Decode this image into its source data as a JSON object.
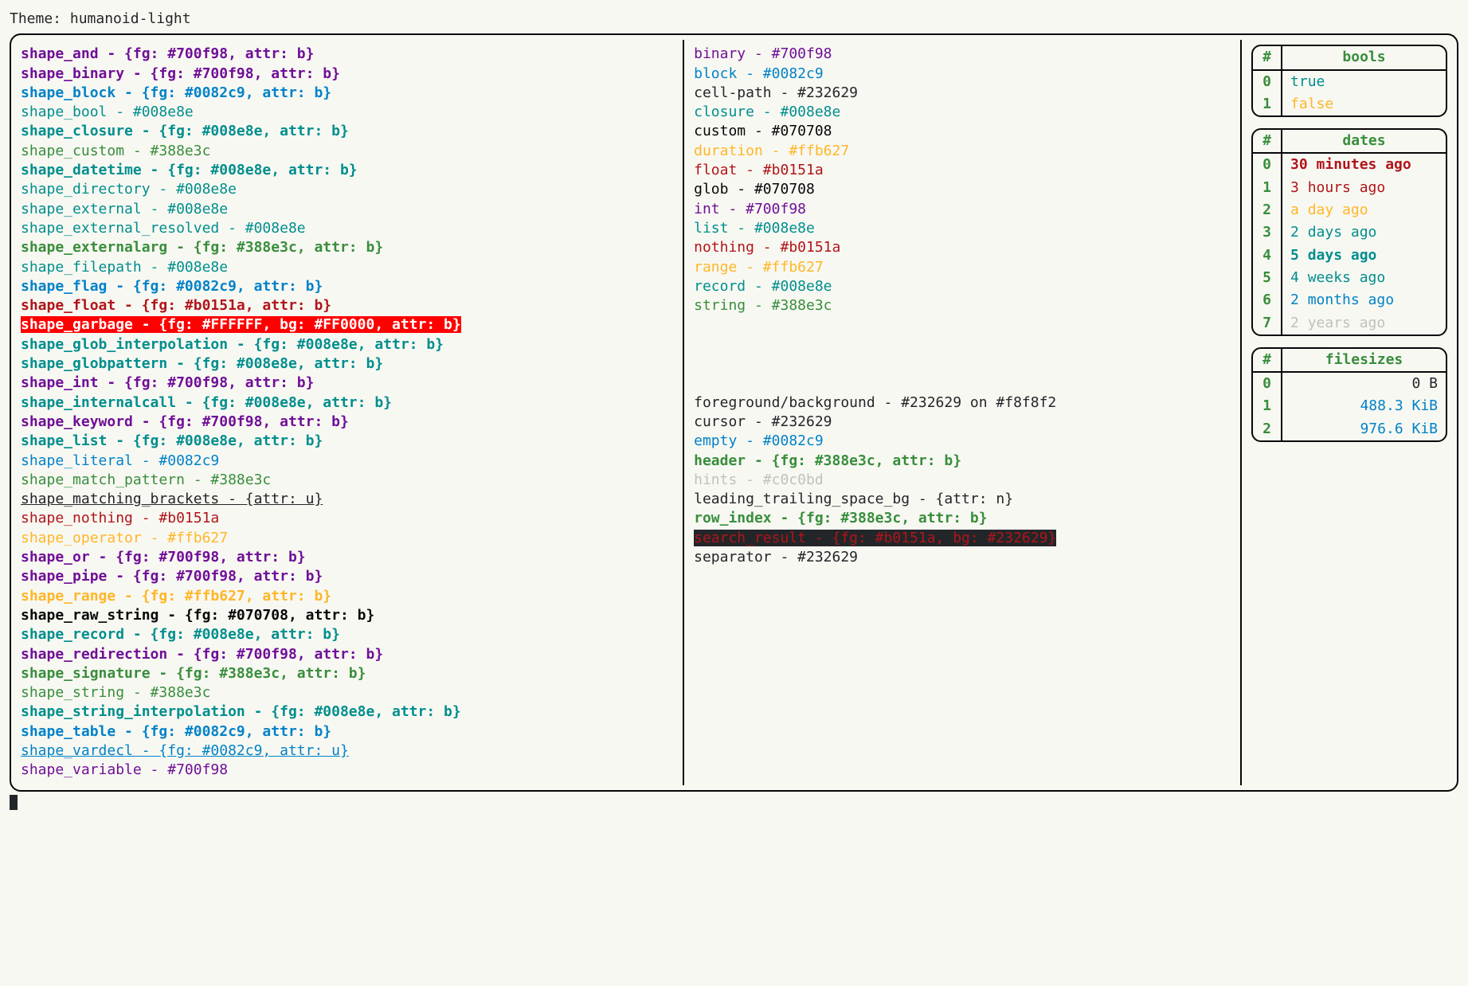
{
  "header": {
    "label": "Theme:",
    "name": "humanoid-light"
  },
  "palette": {
    "purple": "#700f98",
    "blue": "#0082c9",
    "teal": "#008e8e",
    "green": "#388e3c",
    "red": "#b0151a",
    "orange": "#ffb627",
    "black": "#070708",
    "fg": "#232629",
    "bg": "#f8f8f2",
    "hint": "#c0c0bd",
    "white": "#FFFFFF",
    "brightred": "#FF0000"
  },
  "shapes": [
    {
      "name": "shape_and",
      "val": "{fg: #700f98, attr: b}",
      "color": "purple",
      "bold": true
    },
    {
      "name": "shape_binary",
      "val": "{fg: #700f98, attr: b}",
      "color": "purple",
      "bold": true
    },
    {
      "name": "shape_block",
      "val": "{fg: #0082c9, attr: b}",
      "color": "blue",
      "bold": true
    },
    {
      "name": "shape_bool",
      "val": "#008e8e",
      "color": "teal",
      "bold": false
    },
    {
      "name": "shape_closure",
      "val": "{fg: #008e8e, attr: b}",
      "color": "teal",
      "bold": true
    },
    {
      "name": "shape_custom",
      "val": "#388e3c",
      "color": "green",
      "bold": false
    },
    {
      "name": "shape_datetime",
      "val": "{fg: #008e8e, attr: b}",
      "color": "teal",
      "bold": true
    },
    {
      "name": "shape_directory",
      "val": "#008e8e",
      "color": "teal",
      "bold": false
    },
    {
      "name": "shape_external",
      "val": "#008e8e",
      "color": "teal",
      "bold": false
    },
    {
      "name": "shape_external_resolved",
      "val": "#008e8e",
      "color": "teal",
      "bold": false
    },
    {
      "name": "shape_externalarg",
      "val": "{fg: #388e3c, attr: b}",
      "color": "green",
      "bold": true
    },
    {
      "name": "shape_filepath",
      "val": "#008e8e",
      "color": "teal",
      "bold": false
    },
    {
      "name": "shape_flag",
      "val": "{fg: #0082c9, attr: b}",
      "color": "blue",
      "bold": true
    },
    {
      "name": "shape_float",
      "val": "{fg: #b0151a, attr: b}",
      "color": "red",
      "bold": true
    },
    {
      "name": "shape_garbage",
      "val": "{fg: #FFFFFF, bg: #FF0000, attr: b}",
      "color": "white",
      "bold": true,
      "bg": "brightred"
    },
    {
      "name": "shape_glob_interpolation",
      "val": "{fg: #008e8e, attr: b}",
      "color": "teal",
      "bold": true
    },
    {
      "name": "shape_globpattern",
      "val": "{fg: #008e8e, attr: b}",
      "color": "teal",
      "bold": true
    },
    {
      "name": "shape_int",
      "val": "{fg: #700f98, attr: b}",
      "color": "purple",
      "bold": true
    },
    {
      "name": "shape_internalcall",
      "val": "{fg: #008e8e, attr: b}",
      "color": "teal",
      "bold": true
    },
    {
      "name": "shape_keyword",
      "val": "{fg: #700f98, attr: b}",
      "color": "purple",
      "bold": true
    },
    {
      "name": "shape_list",
      "val": "{fg: #008e8e, attr: b}",
      "color": "teal",
      "bold": true
    },
    {
      "name": "shape_literal",
      "val": "#0082c9",
      "color": "blue",
      "bold": false
    },
    {
      "name": "shape_match_pattern",
      "val": "#388e3c",
      "color": "green",
      "bold": false
    },
    {
      "name": "shape_matching_brackets",
      "val": "{attr: u}",
      "color": "fg",
      "bold": false,
      "underline": true
    },
    {
      "name": "shape_nothing",
      "val": "#b0151a",
      "color": "red",
      "bold": false
    },
    {
      "name": "shape_operator",
      "val": "#ffb627",
      "color": "orange",
      "bold": false
    },
    {
      "name": "shape_or",
      "val": "{fg: #700f98, attr: b}",
      "color": "purple",
      "bold": true
    },
    {
      "name": "shape_pipe",
      "val": "{fg: #700f98, attr: b}",
      "color": "purple",
      "bold": true
    },
    {
      "name": "shape_range",
      "val": "{fg: #ffb627, attr: b}",
      "color": "orange",
      "bold": true
    },
    {
      "name": "shape_raw_string",
      "val": "{fg: #070708, attr: b}",
      "color": "black",
      "bold": true
    },
    {
      "name": "shape_record",
      "val": "{fg: #008e8e, attr: b}",
      "color": "teal",
      "bold": true
    },
    {
      "name": "shape_redirection",
      "val": "{fg: #700f98, attr: b}",
      "color": "purple",
      "bold": true
    },
    {
      "name": "shape_signature",
      "val": "{fg: #388e3c, attr: b}",
      "color": "green",
      "bold": true
    },
    {
      "name": "shape_string",
      "val": "#388e3c",
      "color": "green",
      "bold": false
    },
    {
      "name": "shape_string_interpolation",
      "val": "{fg: #008e8e, attr: b}",
      "color": "teal",
      "bold": true
    },
    {
      "name": "shape_table",
      "val": "{fg: #0082c9, attr: b}",
      "color": "blue",
      "bold": true
    },
    {
      "name": "shape_vardecl",
      "val": "{fg: #0082c9, attr: u}",
      "color": "blue",
      "bold": false,
      "underline": true
    },
    {
      "name": "shape_variable",
      "val": "#700f98",
      "color": "purple",
      "bold": false
    }
  ],
  "types": [
    {
      "name": "binary",
      "val": "#700f98",
      "color": "purple"
    },
    {
      "name": "block",
      "val": "#0082c9",
      "color": "blue"
    },
    {
      "name": "cell-path",
      "val": "#232629",
      "color": "fg"
    },
    {
      "name": "closure",
      "val": "#008e8e",
      "color": "teal"
    },
    {
      "name": "custom",
      "val": "#070708",
      "color": "black"
    },
    {
      "name": "duration",
      "val": "#ffb627",
      "color": "orange"
    },
    {
      "name": "float",
      "val": "#b0151a",
      "color": "red"
    },
    {
      "name": "glob",
      "val": "#070708",
      "color": "black"
    },
    {
      "name": "int",
      "val": "#700f98",
      "color": "purple"
    },
    {
      "name": "list",
      "val": "#008e8e",
      "color": "teal"
    },
    {
      "name": "nothing",
      "val": "#b0151a",
      "color": "red"
    },
    {
      "name": "range",
      "val": "#ffb627",
      "color": "orange"
    },
    {
      "name": "record",
      "val": "#008e8e",
      "color": "teal"
    },
    {
      "name": "string",
      "val": "#388e3c",
      "color": "green"
    }
  ],
  "misc": [
    {
      "name": "foreground/background",
      "val": "#232629 on #f8f8f2",
      "color": "fg"
    },
    {
      "name": "cursor",
      "val": "#232629",
      "color": "fg"
    },
    {
      "name": "empty",
      "val": "#0082c9",
      "color": "blue"
    },
    {
      "name": "header",
      "val": "{fg: #388e3c, attr: b}",
      "color": "green",
      "bold": true
    },
    {
      "name": "hints",
      "val": "#c0c0bd",
      "color": "hint"
    },
    {
      "name": "leading_trailing_space_bg",
      "val": "{attr: n}",
      "color": "fg"
    },
    {
      "name": "row_index",
      "val": "{fg: #388e3c, attr: b}",
      "color": "green",
      "bold": true
    },
    {
      "name": "search_result",
      "val": "{fg: #b0151a, bg: #232629}",
      "color": "red",
      "bg": "fg"
    },
    {
      "name": "separator",
      "val": "#232629",
      "color": "fg"
    }
  ],
  "tables": {
    "bools": {
      "header": "bools",
      "rows": [
        {
          "idx": "0",
          "val": "true",
          "color": "teal"
        },
        {
          "idx": "1",
          "val": "false",
          "color": "orange"
        }
      ]
    },
    "dates": {
      "header": "dates",
      "rows": [
        {
          "idx": "0",
          "val": "30 minutes ago",
          "color": "red",
          "bold": true
        },
        {
          "idx": "1",
          "val": "3 hours ago",
          "color": "red"
        },
        {
          "idx": "2",
          "val": "a day ago",
          "color": "orange"
        },
        {
          "idx": "3",
          "val": "2 days ago",
          "color": "teal"
        },
        {
          "idx": "4",
          "val": "5 days ago",
          "color": "teal",
          "bold": true
        },
        {
          "idx": "5",
          "val": "4 weeks ago",
          "color": "teal"
        },
        {
          "idx": "6",
          "val": "2 months ago",
          "color": "blue"
        },
        {
          "idx": "7",
          "val": "2 years ago",
          "color": "hint"
        }
      ]
    },
    "filesizes": {
      "header": "filesizes",
      "rows": [
        {
          "idx": "0",
          "val": "0 B",
          "color": "fg"
        },
        {
          "idx": "1",
          "val": "488.3 KiB",
          "color": "blue"
        },
        {
          "idx": "2",
          "val": "976.6 KiB",
          "color": "blue"
        }
      ]
    }
  },
  "hash": "#",
  "sep": " - "
}
